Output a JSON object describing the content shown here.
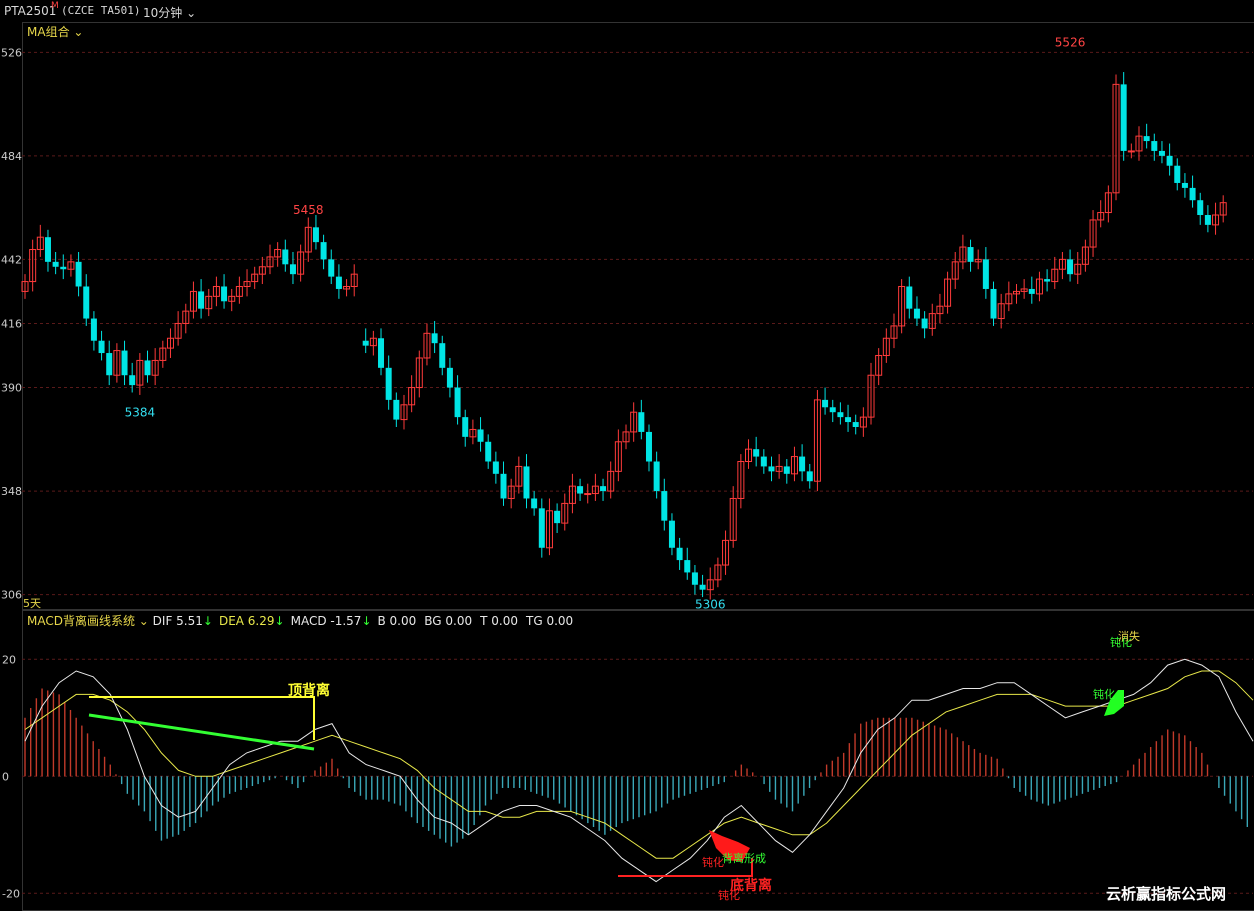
{
  "header": {
    "symbol": "PTA2501",
    "symbol_mark": "M",
    "exchange_code": "(CZCE TA501)",
    "period": "10分钟"
  },
  "top_panel": {
    "indicator_label": "MA组合",
    "period_label": "5天"
  },
  "bottom_panel": {
    "indicator_label": "MACD背离画线系统",
    "readouts": [
      {
        "label": "DIF",
        "value": "5.51",
        "arrow": "↓",
        "color": "#e8e8e8"
      },
      {
        "label": "DEA",
        "value": "6.29",
        "arrow": "↓",
        "color": "#e8e84a"
      },
      {
        "label": "MACD",
        "value": "-1.57",
        "arrow": "↓",
        "color": "#e8e8e8"
      },
      {
        "label": "B",
        "value": "0.00",
        "arrow": "",
        "color": "#e8e8e8"
      },
      {
        "label": "BG",
        "value": "0.00",
        "arrow": "",
        "color": "#e8e8e8"
      },
      {
        "label": "T",
        "value": "0.00",
        "arrow": "",
        "color": "#e8e8e8"
      },
      {
        "label": "TG",
        "value": "0.00",
        "arrow": "",
        "color": "#e8e8e8"
      }
    ]
  },
  "annotations": {
    "top_divergence": "顶背离",
    "bottom_divergence": "底背离",
    "blunt_1": "钝化",
    "blunt_2": "钝化",
    "blunt_3": "钝化",
    "blunt_4": "钝化",
    "formed": "背离形成",
    "vanish": "消失"
  },
  "watermark": "云析赢指标公式网",
  "chart_data": [
    {
      "type": "candlestick",
      "ylim": [
        5303,
        5531
      ],
      "y_tick_labels": [
        "526",
        "484",
        "442",
        "416",
        "390",
        "348",
        "306"
      ],
      "y_tick_values": [
        5526,
        5484,
        5442,
        5416,
        5390,
        5348,
        5306
      ],
      "peaks": [
        {
          "index": 37,
          "label": "5458",
          "price": 5458
        },
        {
          "index": 15,
          "label": "5384",
          "price": 5384
        },
        {
          "index": 89,
          "label": "5306",
          "price": 5306
        },
        {
          "index": 136,
          "label": "5526",
          "price": 5526
        }
      ],
      "gaps_after_index": [
        43
      ],
      "colors": {
        "up": "#ff3b3b",
        "down": "#00e5e5"
      },
      "closes": [
        5433,
        5446,
        5451,
        5441,
        5439,
        5438,
        5441,
        5431,
        5418,
        5409,
        5404,
        5395,
        5405,
        5395,
        5391,
        5401,
        5395,
        5401,
        5406,
        5410,
        5416,
        5421,
        5429,
        5422,
        5427,
        5431,
        5425,
        5427,
        5431,
        5433,
        5436,
        5439,
        5443,
        5446,
        5440,
        5436,
        5445,
        5455,
        5449,
        5442,
        5435,
        5430,
        5431,
        5436,
        5407,
        5410,
        5398,
        5385,
        5377,
        5383,
        5390,
        5402,
        5412,
        5408,
        5398,
        5390,
        5378,
        5370,
        5373,
        5368,
        5360,
        5355,
        5345,
        5350,
        5358,
        5345,
        5341,
        5325,
        5340,
        5335,
        5343,
        5350,
        5347,
        5347,
        5350,
        5348,
        5356,
        5368,
        5372,
        5380,
        5372,
        5360,
        5348,
        5336,
        5325,
        5320,
        5315,
        5310,
        5308,
        5312,
        5318,
        5328,
        5345,
        5360,
        5365,
        5362,
        5358,
        5356,
        5358,
        5355,
        5362,
        5356,
        5352,
        5385,
        5382,
        5380,
        5378,
        5376,
        5374,
        5378,
        5395,
        5403,
        5410,
        5415,
        5431,
        5422,
        5418,
        5414,
        5420,
        5423,
        5434,
        5441,
        5447,
        5441,
        5442,
        5430,
        5418,
        5424,
        5428,
        5429,
        5430,
        5428,
        5434,
        5433,
        5438,
        5442,
        5436,
        5440,
        5447,
        5458,
        5461,
        5469,
        5513,
        5486,
        5486,
        5492,
        5490,
        5486,
        5484,
        5480,
        5473,
        5471,
        5466,
        5460,
        5456,
        5460,
        5465
      ]
    },
    {
      "type": "macd",
      "ylim": [
        -22,
        25
      ],
      "y_tick_labels": [
        "20",
        "0",
        "-20"
      ],
      "y_tick_values": [
        20,
        0,
        -20
      ],
      "series": [
        {
          "name": "DIF",
          "color": "#e8e8e8",
          "values": [
            6,
            12,
            16,
            18,
            17,
            14,
            8,
            0,
            -5,
            -7,
            -6,
            -2,
            2,
            4,
            5,
            6,
            6,
            8,
            9,
            4,
            2,
            1,
            0,
            -4,
            -7,
            -8,
            -10,
            -8,
            -6,
            -5,
            -5,
            -6,
            -7,
            -9,
            -11,
            -14,
            -16,
            -18,
            -16,
            -14,
            -11,
            -7,
            -5,
            -8,
            -11,
            -13,
            -10,
            -6,
            -2,
            4,
            8,
            10,
            13,
            13,
            14,
            15,
            15,
            16,
            16,
            14,
            12,
            10,
            11,
            12,
            13,
            14,
            16,
            19,
            20,
            19,
            17,
            11,
            6
          ]
        },
        {
          "name": "DEA",
          "color": "#e8e84a",
          "values": [
            8,
            10,
            12,
            14,
            14,
            13,
            11,
            8,
            4,
            1,
            0,
            0,
            1,
            2,
            3,
            4,
            5,
            6,
            7,
            6,
            5,
            4,
            3,
            1,
            -2,
            -4,
            -6,
            -6,
            -7,
            -7,
            -6,
            -6,
            -6,
            -7,
            -8,
            -10,
            -12,
            -14,
            -14,
            -12,
            -10,
            -8,
            -7,
            -8,
            -9,
            -10,
            -10,
            -8,
            -5,
            -2,
            1,
            4,
            7,
            9,
            11,
            12,
            13,
            14,
            14,
            14,
            13,
            12,
            12,
            12,
            12,
            13,
            14,
            15,
            17,
            18,
            18,
            16,
            13
          ]
        },
        {
          "name": "MACD",
          "color": "#ff3b3b",
          "values": [
            10,
            15,
            14,
            10,
            6,
            2,
            -3,
            -6,
            -11,
            -10,
            -8,
            -5,
            -3,
            -2,
            -1,
            0,
            -2,
            1,
            3,
            -2,
            -4,
            -4,
            -5,
            -8,
            -10,
            -12,
            -10,
            -5,
            -2,
            -2,
            -3,
            -4,
            -6,
            -8,
            -10,
            -8,
            -7,
            -6,
            -4,
            -3,
            -2,
            -1,
            2,
            0,
            -4,
            -6,
            -2,
            2,
            4,
            9,
            10,
            10,
            10,
            9,
            8,
            6,
            4,
            3,
            -2,
            -4,
            -5,
            -4,
            -3,
            -2,
            -1,
            2,
            5,
            8,
            7,
            4,
            -2,
            -6,
            -10
          ]
        }
      ]
    }
  ]
}
